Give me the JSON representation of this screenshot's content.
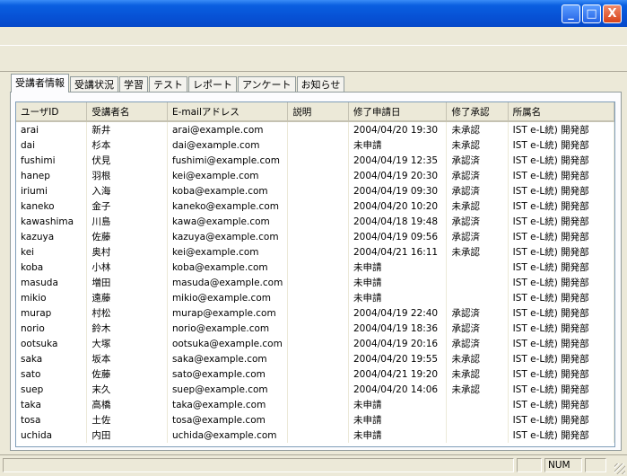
{
  "window": {
    "minimize": "_",
    "maximize": "□",
    "close": "X"
  },
  "tabs": [
    "受講者情報",
    "受講状況",
    "学習",
    "テスト",
    "レポート",
    "アンケート",
    "お知らせ"
  ],
  "columns": [
    "ユーザID",
    "受講者名",
    "E-mailアドレス",
    "説明",
    "修了申請日",
    "修了承認",
    "所属名"
  ],
  "rows": [
    [
      "arai",
      "新井",
      "arai@example.com",
      "",
      "2004/04/20 19:30",
      "未承認",
      "IST e-L統) 開発部"
    ],
    [
      "dai",
      "杉本",
      "dai@example.com",
      "",
      "未申請",
      "未承認",
      "IST e-L統) 開発部"
    ],
    [
      "fushimi",
      "伏見",
      "fushimi@example.com",
      "",
      "2004/04/19 12:35",
      "承認済",
      "IST e-L統) 開発部"
    ],
    [
      "hanep",
      "羽根",
      "kei@example.com",
      "",
      "2004/04/19 20:30",
      "承認済",
      "IST e-L統) 開発部"
    ],
    [
      "iriumi",
      "入海",
      "koba@example.com",
      "",
      "2004/04/19 09:30",
      "承認済",
      "IST e-L統) 開発部"
    ],
    [
      "kaneko",
      "金子",
      "kaneko@example.com",
      "",
      "2004/04/20 10:20",
      "未承認",
      "IST e-L統) 開発部"
    ],
    [
      "kawashima",
      "川島",
      "kawa@example.com",
      "",
      "2004/04/18 19:48",
      "承認済",
      "IST e-L統) 開発部"
    ],
    [
      "kazuya",
      "佐藤",
      "kazuya@example.com",
      "",
      "2004/04/19 09:56",
      "承認済",
      "IST e-L統) 開発部"
    ],
    [
      "kei",
      "奥村",
      "kei@example.com",
      "",
      "2004/04/21 16:11",
      "未承認",
      "IST e-L統) 開発部"
    ],
    [
      "koba",
      "小林",
      "koba@example.com",
      "",
      "未申請",
      "",
      "IST e-L統) 開発部"
    ],
    [
      "masuda",
      "増田",
      "masuda@example.com",
      "",
      "未申請",
      "",
      "IST e-L統) 開発部"
    ],
    [
      "mikio",
      "遠藤",
      "mikio@example.com",
      "",
      "未申請",
      "",
      "IST e-L統) 開発部"
    ],
    [
      "murap",
      "村松",
      "murap@example.com",
      "",
      "2004/04/19 22:40",
      "承認済",
      "IST e-L統) 開発部"
    ],
    [
      "norio",
      "鈴木",
      "norio@example.com",
      "",
      "2004/04/19 18:36",
      "承認済",
      "IST e-L統) 開発部"
    ],
    [
      "ootsuka",
      "大塚",
      "ootsuka@example.com",
      "",
      "2004/04/19 20:16",
      "承認済",
      "IST e-L統) 開発部"
    ],
    [
      "saka",
      "坂本",
      "saka@example.com",
      "",
      "2004/04/20 19:55",
      "未承認",
      "IST e-L統) 開発部"
    ],
    [
      "sato",
      "佐藤",
      "sato@example.com",
      "",
      "2004/04/21 19:20",
      "未承認",
      "IST e-L統) 開発部"
    ],
    [
      "suep",
      "末久",
      "suep@example.com",
      "",
      "2004/04/20 14:06",
      "未承認",
      "IST e-L統) 開発部"
    ],
    [
      "taka",
      "高橋",
      "taka@example.com",
      "",
      "未申請",
      "",
      "IST e-L統) 開発部"
    ],
    [
      "tosa",
      "土佐",
      "tosa@example.com",
      "",
      "未申請",
      "",
      "IST e-L統) 開発部"
    ],
    [
      "uchida",
      "内田",
      "uchida@example.com",
      "",
      "未申請",
      "",
      "IST e-L統) 開発部"
    ]
  ],
  "statusbar": {
    "num": "NUM"
  }
}
